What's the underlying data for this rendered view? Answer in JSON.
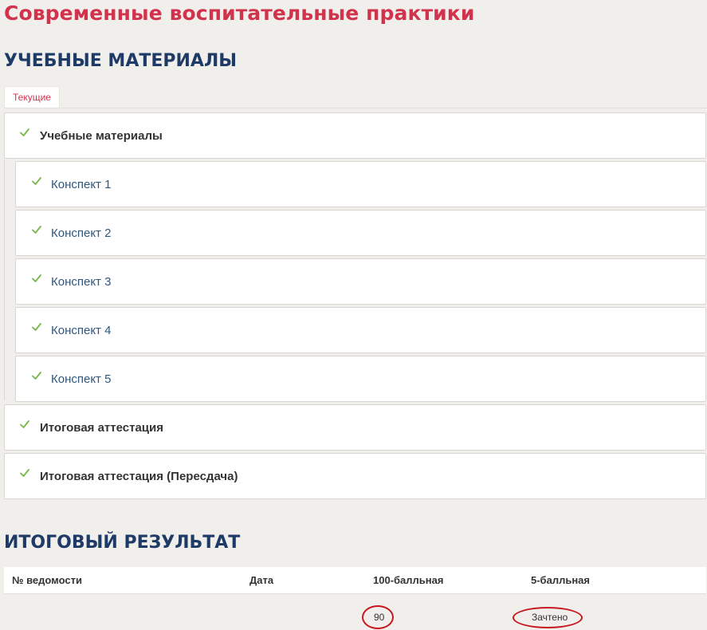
{
  "page": {
    "course_title": "Современные воспитательные практики",
    "materials_heading": "УЧЕБНЫЕ МАТЕРИАЛЫ",
    "results_heading": "ИТОГОВЫЙ РЕЗУЛЬТАТ"
  },
  "tabs": [
    {
      "label": "Текущие",
      "active": true
    }
  ],
  "modules": {
    "group": {
      "label": "Учебные материалы",
      "done": true
    },
    "items": [
      {
        "label": "Конспект 1",
        "done": true
      },
      {
        "label": "Конспект 2",
        "done": true
      },
      {
        "label": "Конспект 3",
        "done": true
      },
      {
        "label": "Конспект 4",
        "done": true
      },
      {
        "label": "Конспект 5",
        "done": true
      }
    ],
    "final": {
      "label": "Итоговая аттестация",
      "done": true
    },
    "retake": {
      "label": "Итоговая аттестация (Пересдача)",
      "done": true
    }
  },
  "results": {
    "columns": [
      "№ ведомости",
      "Дата",
      "100-балльная",
      "5-балльная"
    ],
    "rows": [
      {
        "record_no": "",
        "date": "",
        "score100": "90",
        "score5": "Зачтено"
      }
    ]
  },
  "colors": {
    "title": "#d2334c",
    "heading": "#1e3a66",
    "check": "#7ab648",
    "link": "#2e5780",
    "annotation": "#c8161d"
  },
  "icons": {
    "check": "check-icon"
  }
}
